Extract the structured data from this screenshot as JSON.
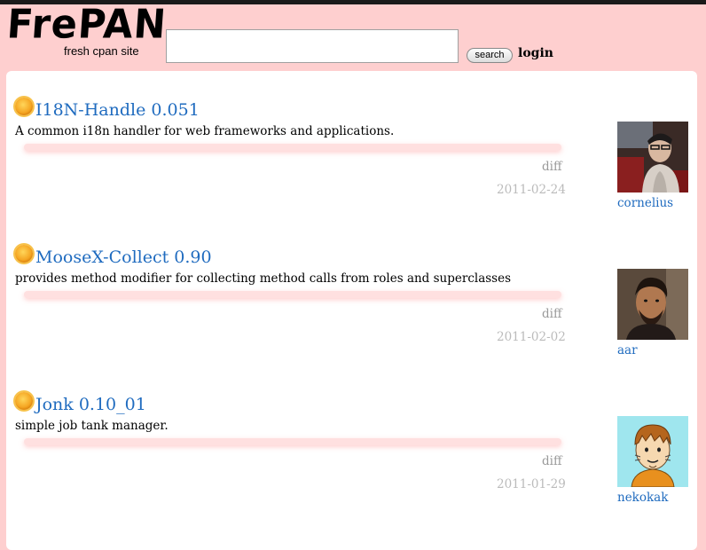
{
  "header": {
    "logo_text": "FrePAN",
    "tagline": "fresh cpan site",
    "search": {
      "value": "",
      "placeholder": ""
    },
    "search_button_label": "search",
    "login_label": "login"
  },
  "entries": [
    {
      "title": "I18N-Handle 0.051",
      "description": "A common i18n handler for web frameworks and applications.",
      "diff_label": "diff",
      "date": "2011-02-24",
      "author": "cornelius"
    },
    {
      "title": "MooseX-Collect 0.90",
      "description": "provides method modifier for collecting method calls from roles and superclasses",
      "diff_label": "diff",
      "date": "2011-02-02",
      "author": "aar"
    },
    {
      "title": "Jonk 0.10_01",
      "description": "simple job tank manager.",
      "diff_label": "diff",
      "date": "2011-01-29",
      "author": "nekokak"
    }
  ],
  "colors": {
    "page_background": "#fecfcf",
    "link": "#1f6bbf",
    "muted_text": "#999999",
    "date_text": "#bbbbbb"
  },
  "icons": [
    "sun-icon",
    "avatar-photo",
    "avatar-cartoon"
  ]
}
